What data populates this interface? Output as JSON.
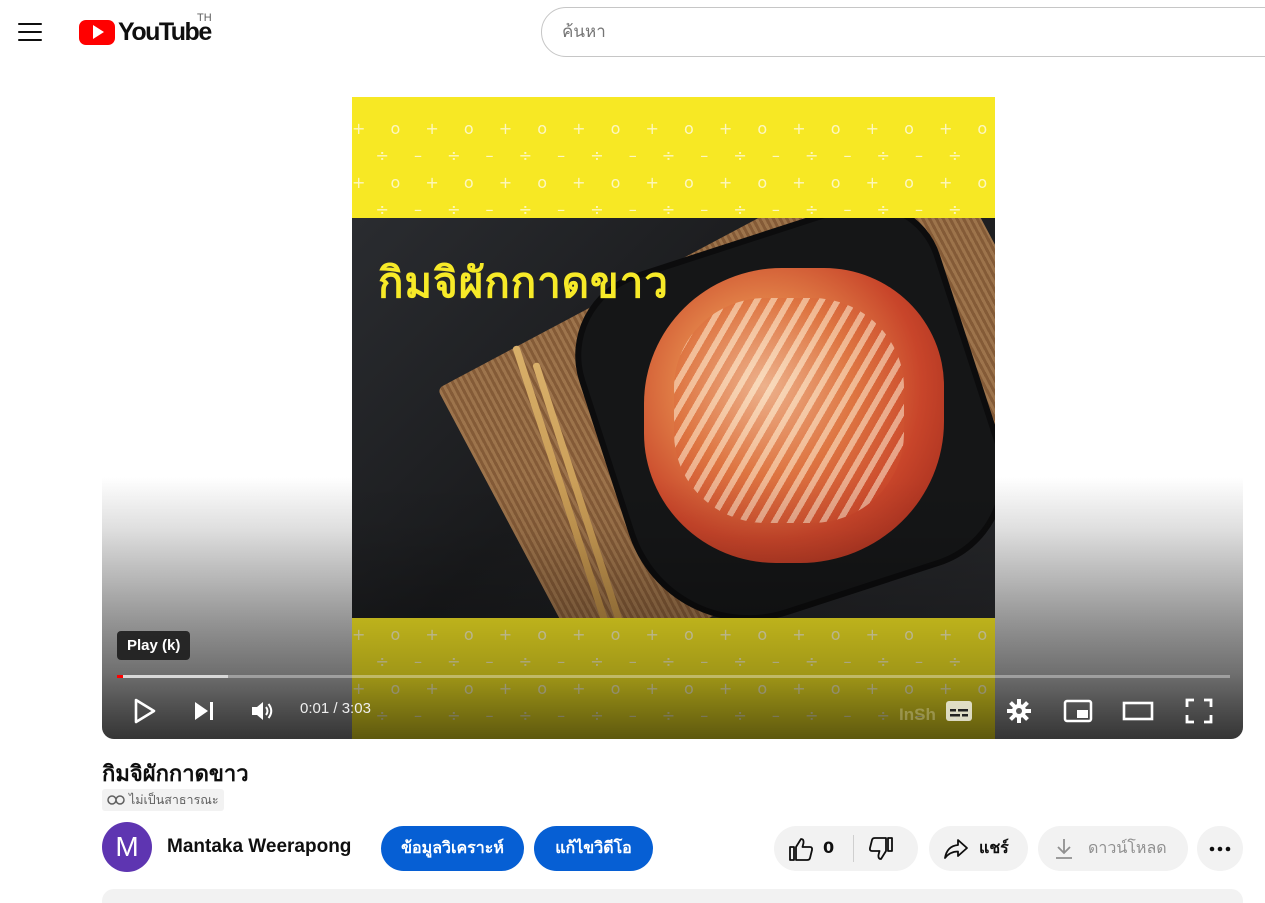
{
  "header": {
    "logo_text": "YouTube",
    "region": "TH",
    "search_placeholder": "ค้นหา"
  },
  "player": {
    "thumbnail_title": "กิมจิผักกาดขาว",
    "tooltip": "Play (k)",
    "current_time": "0:01",
    "separator": " / ",
    "duration": "3:03",
    "played_fraction": 0.005,
    "buffered_fraction": 0.1,
    "watermark": "InSh"
  },
  "video": {
    "title": "กิมจิผักกาดขาว",
    "privacy": "ไม่เป็นสาธารณะ"
  },
  "channel": {
    "avatar_letter": "M",
    "name": "Mantaka Weerapong",
    "avatar_color": "#5e35b1"
  },
  "actions": {
    "analytics": "ข้อมูลวิเคราะห์",
    "edit": "แก้ไขวิดีโอ",
    "like_count": "0",
    "share": "แชร์",
    "download": "ดาวน์โหลด"
  },
  "colors": {
    "accent": "#065fd4",
    "brand": "#ff0000",
    "thumbnail_yellow": "#f7e824"
  }
}
